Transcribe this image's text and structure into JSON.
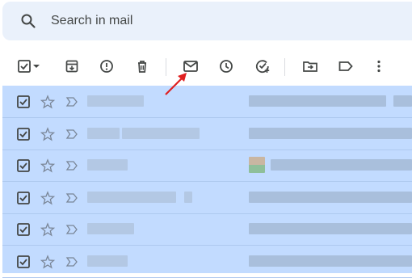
{
  "search": {
    "placeholder": "Search in mail",
    "icon": "search-icon"
  },
  "toolbar": {
    "icons": [
      "select-checkbox-icon",
      "select-dropdown-icon",
      "archive-icon",
      "report-spam-icon",
      "delete-icon",
      "mark-as-unread-icon",
      "snooze-icon",
      "add-to-tasks-icon",
      "move-to-icon",
      "label-icon",
      "more-options-icon"
    ],
    "highlighted_button": "mark-as-unread-icon",
    "annotation_arrow_color": "#e02020"
  },
  "email_rows": [
    {
      "selected": true,
      "starred": false
    },
    {
      "selected": true,
      "starred": false
    },
    {
      "selected": true,
      "starred": false
    },
    {
      "selected": true,
      "starred": false
    },
    {
      "selected": true,
      "starred": false
    },
    {
      "selected": true,
      "starred": false
    }
  ],
  "colors": {
    "search_bg": "#eaf1fb",
    "selected_row_bg": "#c2dbff",
    "icon": "#444746",
    "annotation_arrow": "#e02020"
  }
}
